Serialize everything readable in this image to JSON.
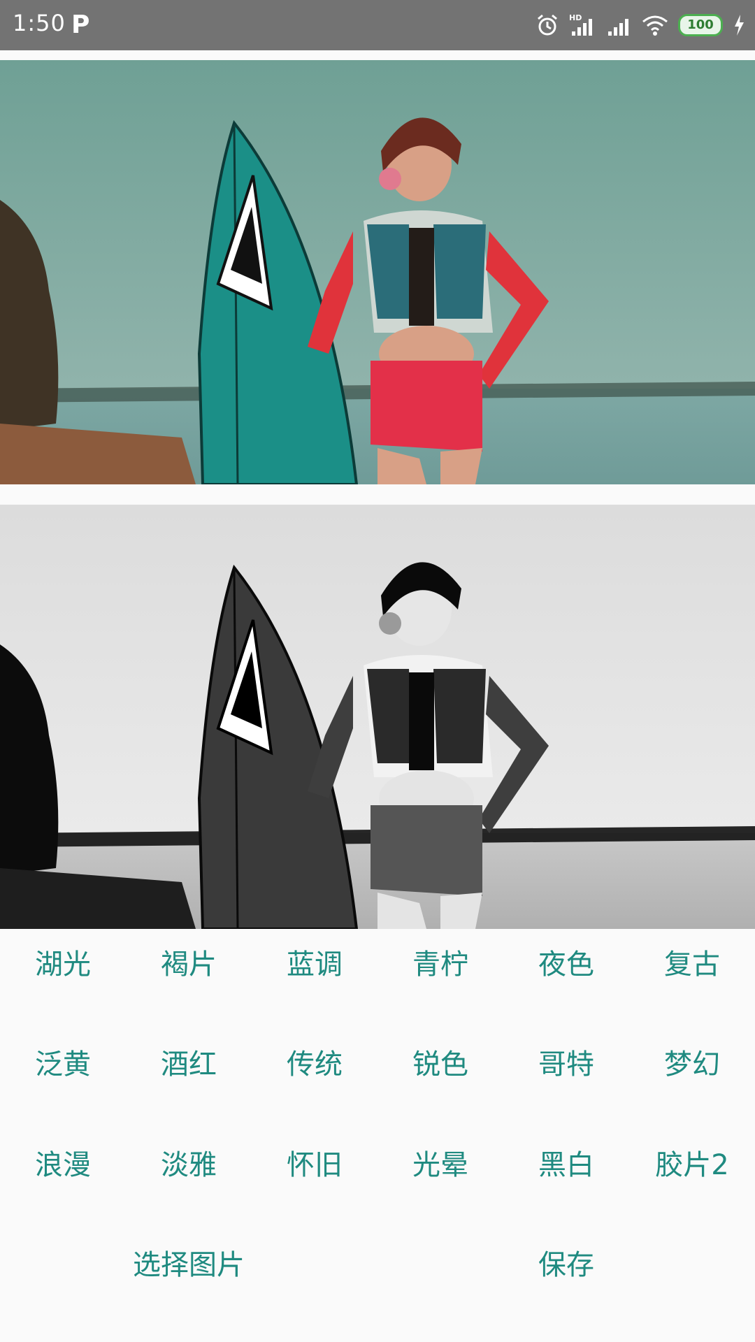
{
  "status_bar": {
    "time": "1:50",
    "notification_icon": "p-icon",
    "icons": [
      "alarm-icon",
      "signal-hd-icon",
      "signal-icon",
      "wifi-icon",
      "battery-icon",
      "charging-icon"
    ],
    "battery": "100",
    "hd_label": "HD"
  },
  "images": {
    "original": {
      "description_icon": "photo"
    },
    "filtered": {
      "description_icon": "photo"
    }
  },
  "filters": {
    "row1": [
      "湖光",
      "褐片",
      "蓝调",
      "青柠",
      "夜色",
      "复古"
    ],
    "row2": [
      "泛黄",
      "酒红",
      "传统",
      "锐色",
      "哥特",
      "梦幻"
    ],
    "row3": [
      "浪漫",
      "淡雅",
      "怀旧",
      "光晕",
      "黑白",
      "胶片2"
    ]
  },
  "actions": {
    "select_image": "选择图片",
    "save": "保存"
  },
  "colors": {
    "accent": "#1f8a80",
    "status_bar": "#737373",
    "background": "#fafafa"
  }
}
